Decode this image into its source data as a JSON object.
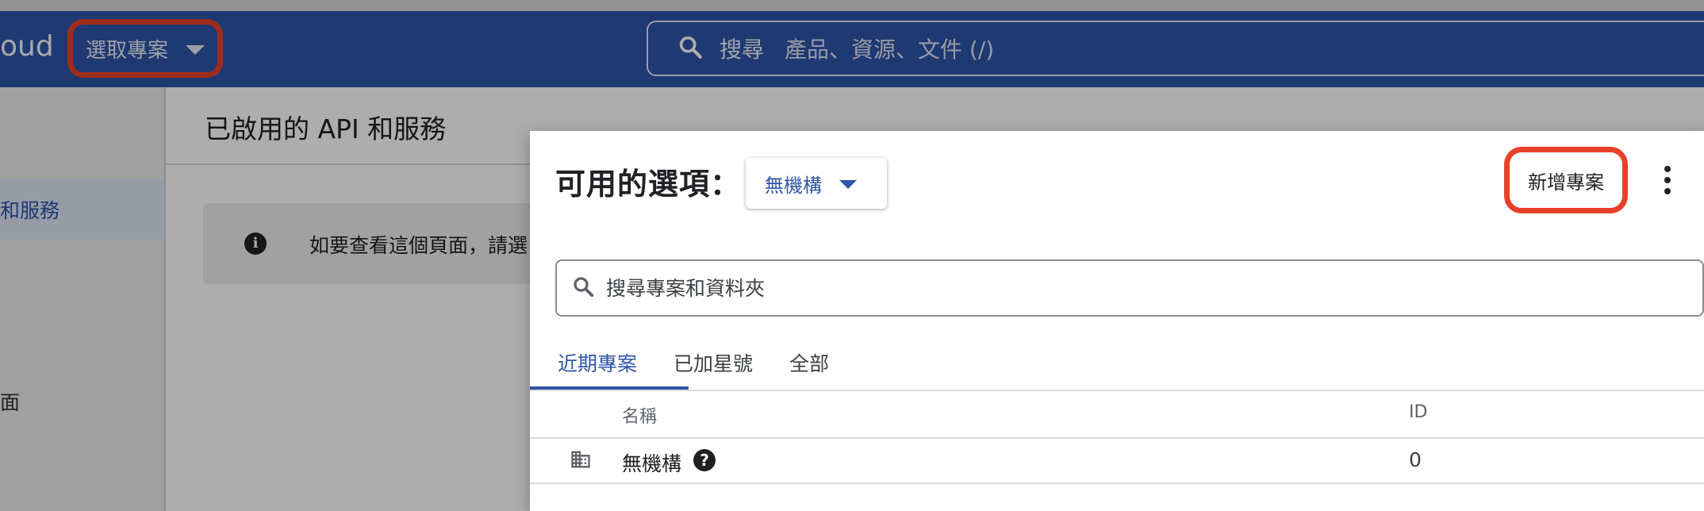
{
  "header": {
    "brand_fragment": "oud",
    "project_picker_label": "選取專案",
    "search_label": "搜尋",
    "search_placeholder": "產品、資源、文件 (/)"
  },
  "sidebar": {
    "active_item_label": "和服務",
    "item2_label": "面"
  },
  "main": {
    "title": "已啟用的 API 和服務",
    "info_text": "如要查看這個頁面，請選"
  },
  "dialog": {
    "title": "可用的選項：",
    "org_select_value": "無機構",
    "new_project_label": "新增專案",
    "search_placeholder": "搜尋專案和資料夾",
    "tabs": [
      {
        "label": "近期專案"
      },
      {
        "label": "已加星號"
      },
      {
        "label": "全部"
      }
    ],
    "columns": {
      "name": "名稱",
      "id": "ID"
    },
    "rows": [
      {
        "name": "無機構",
        "id": "0"
      }
    ]
  },
  "colors": {
    "header_bg": "#2f55a8",
    "accent": "#2f55a8",
    "highlight_outline": "#e8412a"
  }
}
